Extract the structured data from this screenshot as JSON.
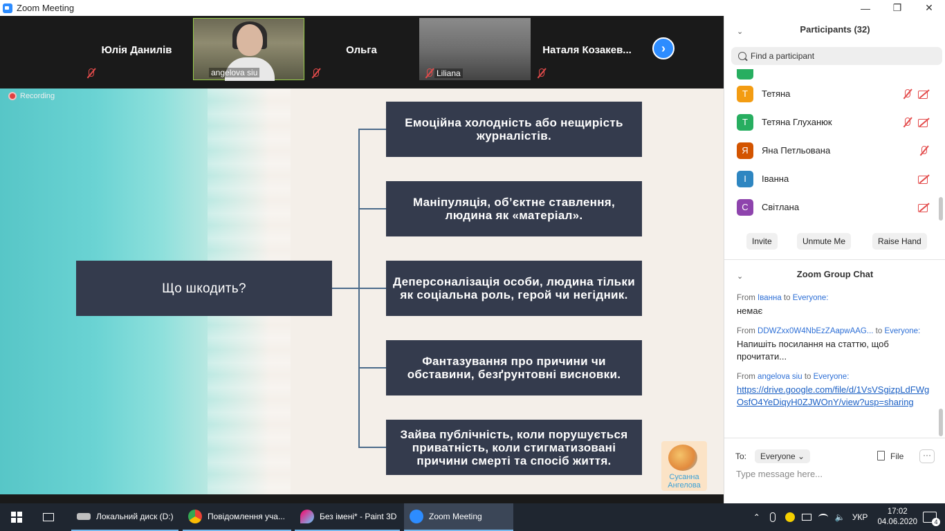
{
  "window": {
    "title": "Zoom Meeting",
    "min": "—",
    "max": "❐",
    "close": "✕"
  },
  "strip": {
    "tiles": [
      {
        "name": "Юлія Данилів"
      },
      {
        "label": "angelova siu"
      },
      {
        "name": "Ольга"
      },
      {
        "label": "Liliana"
      },
      {
        "name": "Наталя  Козакев..."
      }
    ],
    "next": "›"
  },
  "recording": "Recording",
  "slide": {
    "main": "Що шкодить?",
    "items": [
      "Емоційна холодність або нещирість  журналістів.",
      "Маніпуляція, об’єктне ставлення, людина як «матеріал».",
      "Деперсоналізація особи, людина тільки як соціальна роль, герой чи негідник.",
      "Фантазування про причини чи обставини, безґрунтовні висновки.",
      "Зайва публічність, коли порушується приватність, коли стигматизовані причини смерті та спосіб життя."
    ],
    "logo_line1": "Сусанна",
    "logo_line2": "Ангелова"
  },
  "participants": {
    "header": "Participants (32)",
    "search_placeholder": "Find a participant",
    "list": [
      {
        "initial": "Т",
        "name": "Тетяна",
        "color": "#f39c12"
      },
      {
        "initial": "Т",
        "name": "Тетяна Глуханюк",
        "color": "#27ae60"
      },
      {
        "initial": "Я",
        "name": "Яна Петльована",
        "color": "#d35400"
      },
      {
        "initial": "І",
        "name": "Іванна",
        "color": "#2e86c1"
      },
      {
        "initial": "С",
        "name": "Світлана",
        "color": "#8e44ad"
      }
    ],
    "buttons": {
      "invite": "Invite",
      "unmute": "Unmute Me",
      "raise": "Raise Hand"
    }
  },
  "chat": {
    "header": "Zoom Group Chat",
    "messages": [
      {
        "from": "From",
        "sender": "Іванна",
        "to": "to",
        "recipient": "Everyone:",
        "text": "немає"
      },
      {
        "from": "From",
        "sender": "DDWZxx0W4NbEzZAapwAAG...",
        "to": "to",
        "recipient": "Everyone:",
        "text": "Напишіть посилання на статтю, щоб прочитати..."
      },
      {
        "from": "From",
        "sender": "angelova siu",
        "to": "to",
        "recipient": "Everyone:",
        "text": "https://drive.google.com/file/d/1VsVSgizpLdFWgOsfO4YeDiqyH0ZJWOnY/view?usp=sharing"
      }
    ],
    "to_label": "To:",
    "to_value": "Everyone",
    "file_label": "File",
    "more": "···",
    "input_placeholder": "Type message here..."
  },
  "taskbar": {
    "items": [
      {
        "label": "Локальний диск (D:)"
      },
      {
        "label": "Повідомлення уча..."
      },
      {
        "label": "Без імені* - Paint 3D"
      },
      {
        "label": "Zoom Meeting"
      }
    ],
    "lang": "УКР",
    "time": "17:02",
    "date": "04.06.2020",
    "notifications": "4"
  }
}
